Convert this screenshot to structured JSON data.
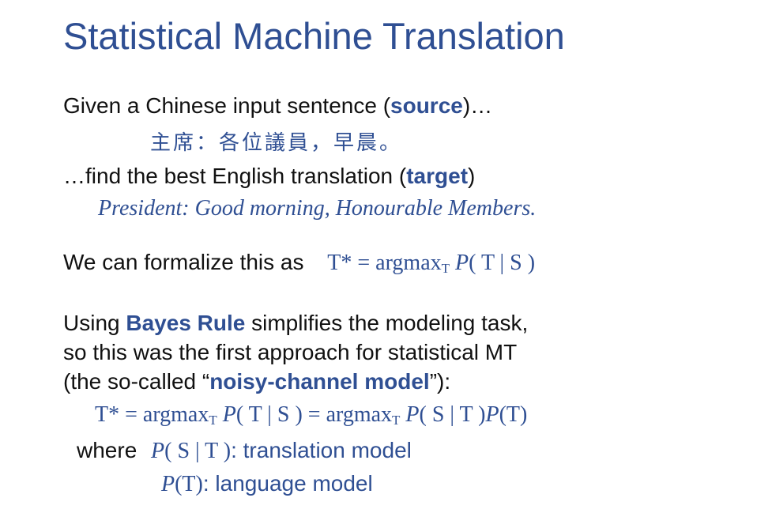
{
  "title": "Statistical Machine Translation",
  "source_line": {
    "prefix": "Given a Chinese input sentence (",
    "term": "source",
    "suffix": ")…"
  },
  "source_sentence": "主席：各位議員，早晨。",
  "target_line": {
    "prefix": "…find the best English translation (",
    "term": "target",
    "suffix": ")"
  },
  "target_sentence": "President:  Good morning, Honourable Members.",
  "formalize": {
    "text": "We can formalize this as",
    "lhs": "T* = argmax",
    "sub": "T",
    "p": "P",
    "args": "( T | S )"
  },
  "bayes": {
    "line1_prefix": "Using ",
    "line1_term": "Bayes Rule",
    "line1_suffix": " simplifies the modeling task,",
    "line2": "so this was the first approach for statistical MT",
    "line3_prefix": "(the so-called “",
    "line3_term": "noisy-channel model",
    "line3_suffix": "”):"
  },
  "equation": {
    "part1": "T* = argmax",
    "sub1": "T",
    "p1": "P",
    "args1": "( T | S ) = argmax",
    "sub2": "T",
    "p2": "P",
    "args2": "( S | T )",
    "p3": "P",
    "args3": "(T)"
  },
  "where": {
    "label": "where",
    "tm_p": "P",
    "tm_args": "( S | T )",
    "tm_desc": ": translation model",
    "lm_p": "P",
    "lm_args": "(T)",
    "lm_desc": ": language model"
  }
}
